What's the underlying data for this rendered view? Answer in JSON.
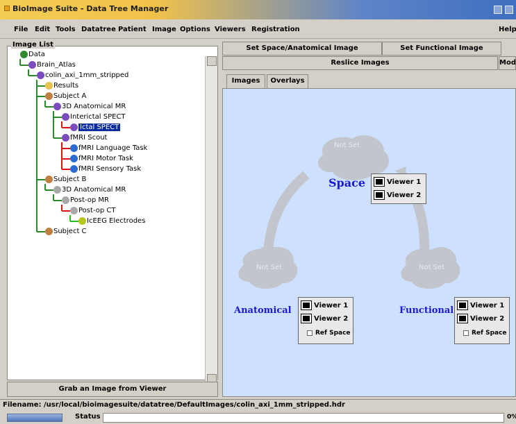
{
  "window": {
    "title": "BioImage Suite - Data Tree Manager"
  },
  "menubar": {
    "file": "File",
    "edit": "Edit",
    "tools": "Tools",
    "datatree": "Datatree",
    "patient": "Patient",
    "image": "Image",
    "options": "Options",
    "viewers": "Viewers",
    "registration": "Registration",
    "help": "Help"
  },
  "image_list": {
    "label": "Image List",
    "tree": [
      "Data",
      "Brain_Atlas",
      "colin_axi_1mm_stripped",
      "Results",
      "Subject A",
      "3D Anatomical MR",
      "Interictal SPECT",
      "Ictal SPECT",
      "fMRI Scout",
      "fMRI Language Task",
      "fMRI Motor Task",
      "fMRI Sensory Task",
      "Subject B",
      "3D Anatomical MR",
      "Post-op MR",
      "Post-op CT",
      "IcEEG Electrodes",
      "Subject C"
    ],
    "grab_button": "Grab an Image from Viewer"
  },
  "controls": {
    "set_space": "Set Space/Anatomical Image",
    "set_functional": "Set Functional Image",
    "reslice": "Reslice Images",
    "mode": "Mode"
  },
  "tabs": {
    "images": "Images",
    "overlays": "Overlays"
  },
  "diagram": {
    "space_label": "Space",
    "anatomical_label": "Anatomical",
    "functional_label": "Functional",
    "not_set": "Not Set",
    "viewer1": "Viewer 1",
    "viewer2": "Viewer 2",
    "ref_space": "Ref Space"
  },
  "filename": "Filename: /usr/local/bioimagesuite/datatree/DefaultImages/colin_axi_1mm_stripped.hdr",
  "status": {
    "label": "Status",
    "pct": "0%"
  },
  "colors": {
    "canvas_bg": "#cde1ff",
    "blue_label": "#1a1ad6",
    "select": "#0b2d9e"
  }
}
